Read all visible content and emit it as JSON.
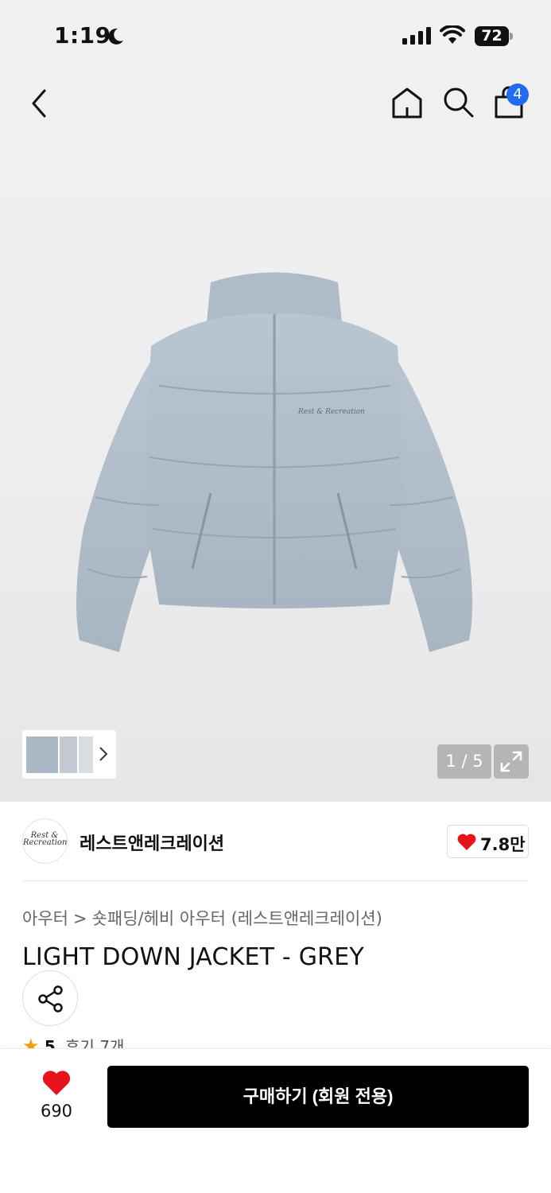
{
  "status_bar": {
    "time": "1:19",
    "battery": "72"
  },
  "header": {
    "cart_count": "4"
  },
  "gallery": {
    "pager": "1 / 5"
  },
  "brand": {
    "logo_text": "Rest & Recreation",
    "name": "레스트앤레크레이션",
    "likes": "7.8만"
  },
  "product": {
    "breadcrumb": [
      "아우터",
      "숏패딩/헤비 아우터 (레스트앤레크레이션)"
    ],
    "breadcrumb_sep": ">",
    "title": "LIGHT DOWN JACKET - GREY",
    "rating_score": "5",
    "reviews": "후기 7개"
  },
  "bottom_bar": {
    "like_count": "690",
    "buy_label": "구매하기 (회원 전용)"
  },
  "colors": {
    "accent_badge": "#1f6cf0",
    "heart": "#e8141c",
    "buy_button": "#000000",
    "star": "#f5a00a"
  }
}
